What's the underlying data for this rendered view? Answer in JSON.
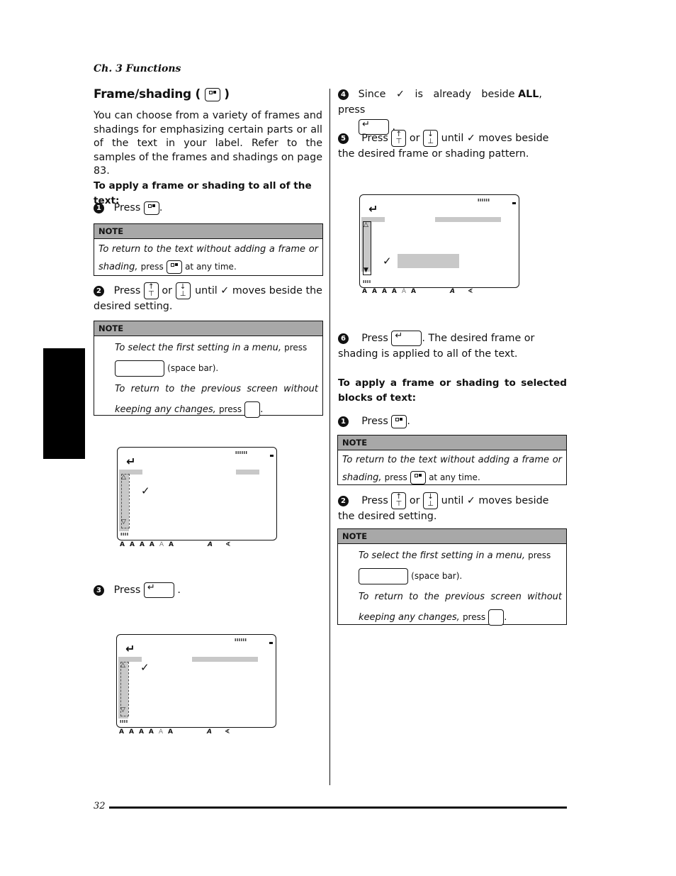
{
  "header": {
    "chapter": "Ch. 3 Functions"
  },
  "section": {
    "title": "Frame/shading (",
    "title_close": ")",
    "intro": "You can choose from a variety of frames and shadings for emphasizing certain parts or all of the text in your label. Refer to the samples of the frames and shadings on page 83."
  },
  "all_text": {
    "heading": "To apply a frame or shading to all of the text:",
    "steps": [
      {
        "num": "1",
        "pre": "Press",
        "post": "."
      },
      {
        "num": "2",
        "pre": "Press",
        "mid": "or",
        "post": "until ✓ moves beside the desired setting."
      },
      {
        "num": "3",
        "pre": "Press",
        "post": "."
      },
      {
        "num": "4",
        "pre": "Since ✓ is already beside",
        "bold": "ALL",
        "post": ", press",
        "end": "."
      },
      {
        "num": "5",
        "pre": "Press",
        "mid": "or",
        "post": "until ✓ moves beside the desired frame or shading pattern."
      },
      {
        "num": "6",
        "pre": "Press",
        "post": ". The desired frame or shading is applied to all of the text."
      }
    ],
    "note1": {
      "label": "NOTE",
      "text_italic": "To return to the text without adding a frame or shading,",
      "text_press": "press",
      "text_end": "at any time."
    },
    "note2": {
      "label": "NOTE",
      "line1_italic": "To select the first setting in a menu,",
      "line1_press": "press",
      "line2": "(space bar).",
      "line3_italic": "To return to the previous screen without keeping any changes,",
      "line3_press": "press",
      "line3_end": "."
    }
  },
  "blocks": {
    "heading": "To apply a frame or shading to selected blocks of text:",
    "steps": [
      {
        "num": "1",
        "pre": "Press",
        "post": "."
      },
      {
        "num": "2",
        "pre": "Press",
        "mid": "or",
        "post": "until ✓ moves beside the desired setting."
      }
    ],
    "note1": {
      "label": "NOTE",
      "text_italic": "To return to the text without adding a frame or shading,",
      "text_press": "press",
      "text_end": "at any time."
    },
    "note2": {
      "label": "NOTE",
      "line1_italic": "To select the first setting in a menu,",
      "line1_press": "press",
      "line2": "(space bar).",
      "line3_italic": "To return to the previous screen without keeping any changes,",
      "line3_press": "press",
      "line3_end": "."
    }
  },
  "keys": {
    "enter_glyph": "↵",
    "up_glyph": "↑",
    "up_sub": "⊤",
    "down_glyph": "↓",
    "down_sub": "⊥"
  },
  "lcd": {
    "enter_glyph": "↵",
    "check_glyph": "✓",
    "ticks_top": "ıııııı",
    "ticks_bottom": "ıııı",
    "scroll_up": "△",
    "scroll_down": "▽",
    "scroll_down_filled": "▼",
    "indicators": [
      "A",
      "A",
      "A",
      "A",
      "A",
      "A",
      "A",
      "∢"
    ]
  },
  "footer": {
    "page_number": "32"
  }
}
